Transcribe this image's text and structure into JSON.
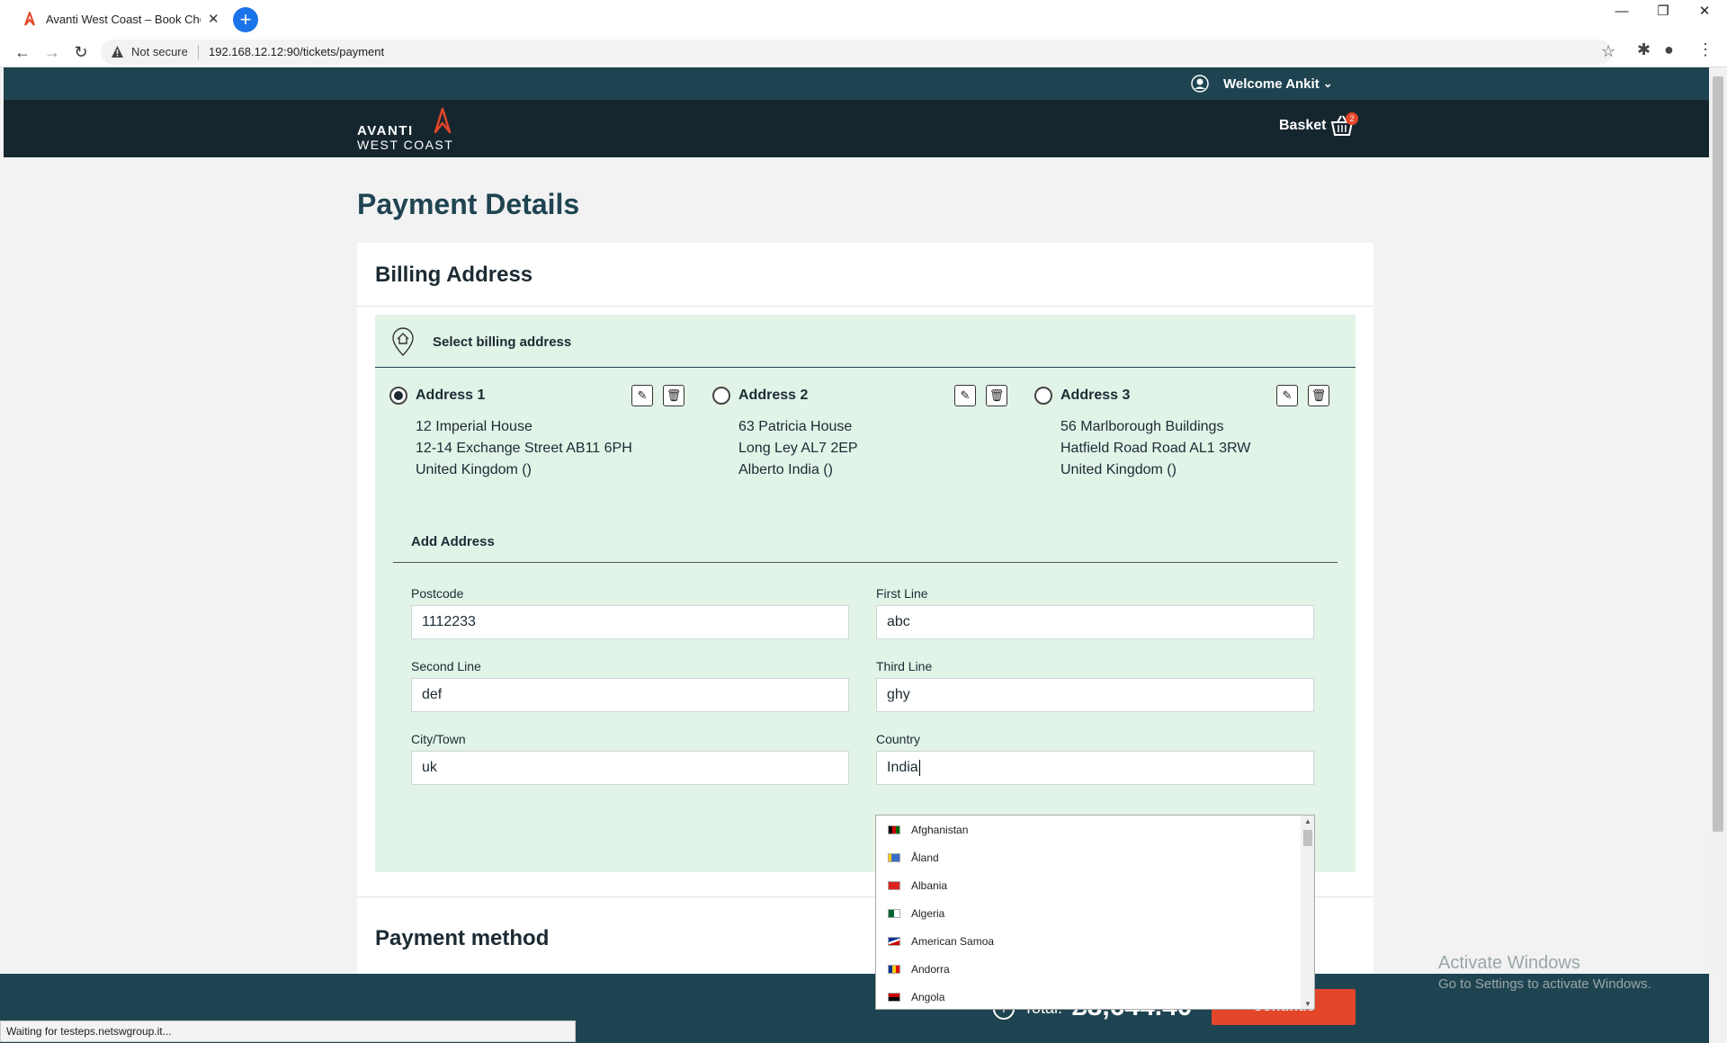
{
  "browser": {
    "tab_title": "Avanti West Coast – Book Cheap",
    "security_label": "Not secure",
    "url": "192.168.12.12:90/tickets/payment",
    "status": "Waiting for testeps.netswgroup.it..."
  },
  "header": {
    "welcome": "Welcome Ankit",
    "logo_line1": "AVANTI",
    "logo_line2": "WEST COAST",
    "basket_label": "Basket",
    "basket_count": "2"
  },
  "page": {
    "title": "Payment Details",
    "billing_title": "Billing Address",
    "select_label": "Select billing address",
    "add_address_label": "Add Address",
    "payment_method_title": "Payment method"
  },
  "addresses": [
    {
      "name": "Address 1",
      "lines": [
        "12 Imperial House",
        "12-14 Exchange Street AB11 6PH",
        "United Kingdom ()"
      ],
      "selected": true
    },
    {
      "name": "Address 2",
      "lines": [
        "63 Patricia House",
        "Long Ley AL7 2EP",
        "Alberto India ()"
      ],
      "selected": false
    },
    {
      "name": "Address 3",
      "lines": [
        "56 Marlborough Buildings",
        "Hatfield Road Road AL1 3RW",
        "United Kingdom ()"
      ],
      "selected": false
    }
  ],
  "form": {
    "postcode": {
      "label": "Postcode",
      "value": "1112233"
    },
    "first_line": {
      "label": "First Line",
      "value": "abc"
    },
    "second_line": {
      "label": "Second Line",
      "value": "def"
    },
    "third_line": {
      "label": "Third Line",
      "value": "ghy"
    },
    "city": {
      "label": "City/Town",
      "value": "uk"
    },
    "country": {
      "label": "Country",
      "value": "India"
    }
  },
  "country_options": [
    "Afghanistan",
    "Åland",
    "Albania",
    "Algeria",
    "American Samoa",
    "Andorra",
    "Angola"
  ],
  "footer": {
    "total_label": "Total:",
    "total_value": "£8,644.40",
    "continue_label": "Continue"
  },
  "watermark": {
    "line1": "Activate Windows",
    "line2": "Go to Settings to activate Windows."
  },
  "colors": {
    "accent": "#e4462a",
    "header_dark": "#16262e",
    "teal": "#1f4451",
    "panel_green": "#e2f3e8"
  }
}
